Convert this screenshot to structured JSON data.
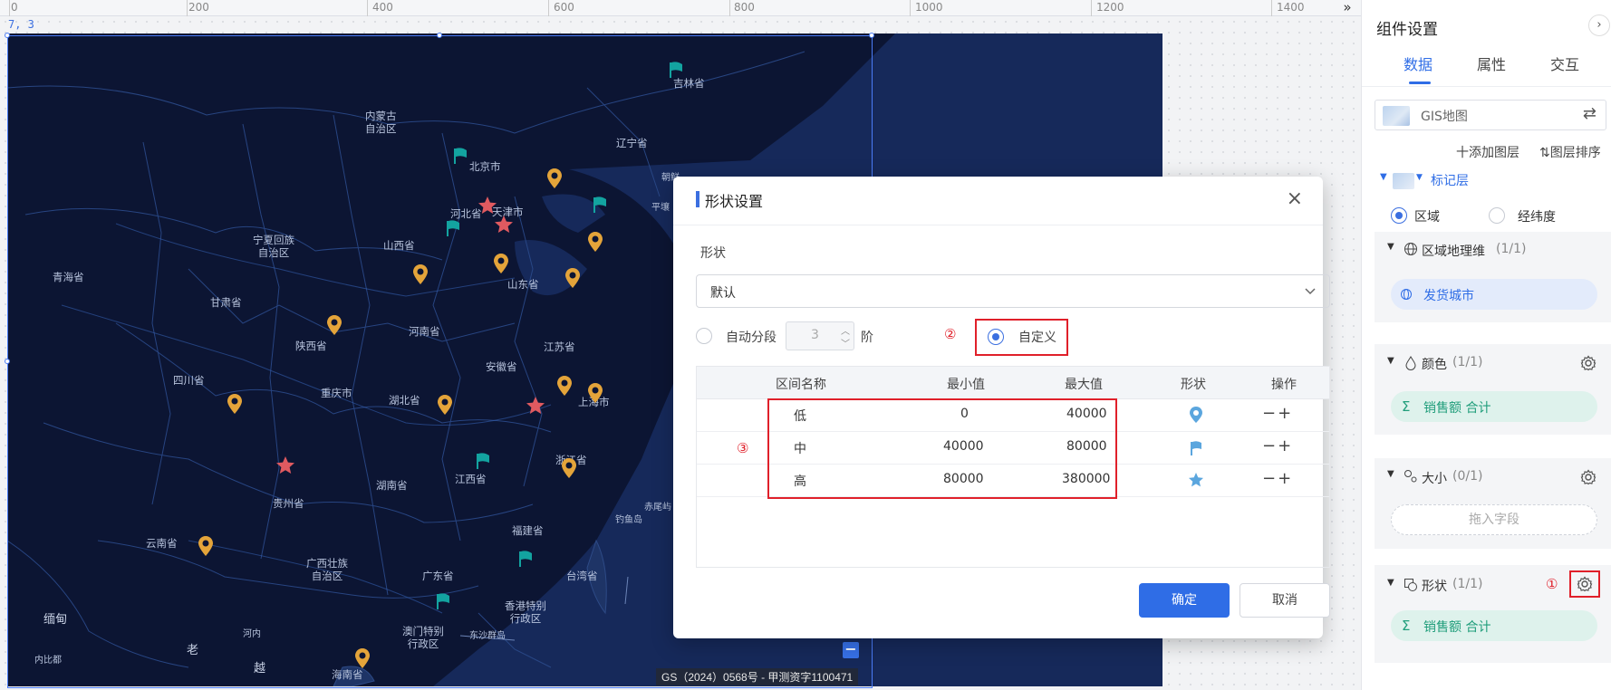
{
  "ruler": {
    "labels": [
      "0",
      "200",
      "400",
      "600",
      "800",
      "1000",
      "1200",
      "1400"
    ],
    "collapse_icon": "»"
  },
  "canvas": {
    "coord_readout": "7, 3"
  },
  "map": {
    "credit": "GS（2024）0568号 - 甲测资字1100471",
    "zoom_out": "−",
    "labels": [
      "吉林省",
      "内蒙古\n自治区",
      "辽宁省",
      "北京市",
      "天津市",
      "河北省",
      "宁夏回族\n自治区",
      "山西省",
      "山东省",
      "青海省",
      "甘肃省",
      "河南省",
      "陕西省",
      "江苏省",
      "安徽省",
      "上海市",
      "四川省",
      "重庆市",
      "湖北省",
      "浙江省",
      "湖南省",
      "江西省",
      "贵州省",
      "福建省",
      "赤尾屿",
      "钓鱼岛",
      "云南省",
      "广西壮族\n自治区",
      "广东省",
      "台湾省",
      "香港特别\n行政区",
      "澳门特别\n行政区",
      "东沙群岛",
      "缅甸",
      "老",
      "河内",
      "越",
      "内比都",
      "海南省",
      "朝鲜",
      "平壤"
    ]
  },
  "dialog": {
    "title": "形状设置",
    "close": "×",
    "shape_label": "形状",
    "shape_value": "默认",
    "auto_segment_label": "自动分段",
    "segments": "3",
    "segments_unit": "阶",
    "custom_label": "自定义",
    "markers": {
      "one": "①",
      "two": "②",
      "three": "③"
    },
    "columns": [
      "区间名称",
      "最小值",
      "最大值",
      "形状",
      "操作"
    ],
    "rows": [
      {
        "name": "低",
        "min": "0",
        "max": "40000",
        "shape_icon": "pin-icon"
      },
      {
        "name": "中",
        "min": "40000",
        "max": "80000",
        "shape_icon": "flag-icon"
      },
      {
        "name": "高",
        "min": "80000",
        "max": "380000",
        "shape_icon": "star-icon"
      }
    ],
    "row_ops": "−+",
    "ok": "确定",
    "cancel": "取消"
  },
  "panel": {
    "title": "组件设置",
    "collapse": "›",
    "tabs": [
      "数据",
      "属性",
      "交互"
    ],
    "active_tab": "数据",
    "component": "GIS地图",
    "add_layer": "十添加图层",
    "layer_sort": "⇅图层排序",
    "layer_name": "标记层",
    "mode_region": "区域",
    "mode_latlng": "经纬度",
    "geo_dim": "区域地理维",
    "geo_dim_count": "(1/1)",
    "geo_field": "发货城市",
    "color": "颜色",
    "color_count": "(1/1)",
    "color_field": "销售额 合计",
    "size": "大小",
    "size_count": "(0/1)",
    "size_field_placeholder": "拖入字段",
    "shape": "形状",
    "shape_count": "(1/1)",
    "shape_field": "销售额 合计"
  },
  "colors": {
    "accent": "#2f6de6",
    "map_bg": "#0c1533",
    "marker_pin": "#e4a43a",
    "marker_flag": "#13a3a0",
    "marker_star": "#e05a60",
    "annotation_red": "#e0202a"
  }
}
